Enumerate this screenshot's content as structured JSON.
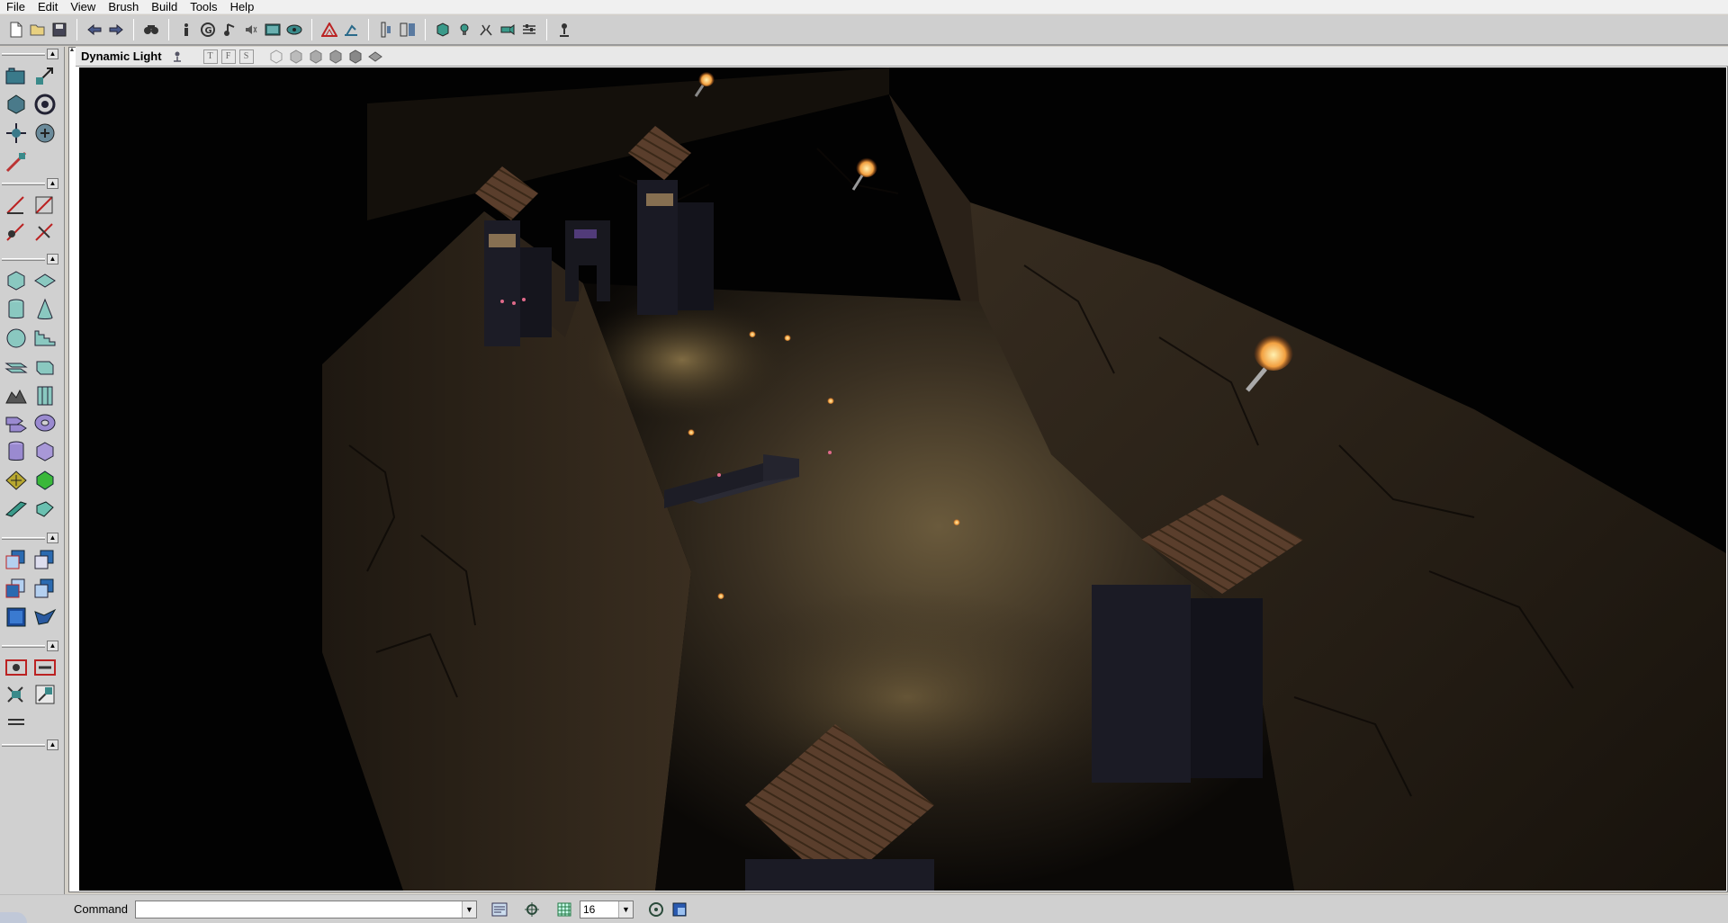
{
  "menubar": {
    "items": [
      "File",
      "Edit",
      "View",
      "Brush",
      "Build",
      "Tools",
      "Help"
    ]
  },
  "toolbar": {
    "icons": [
      "new-map-icon",
      "open-map-icon",
      "save-map-icon",
      "undo-icon",
      "redo-icon",
      "find-actors-icon",
      "actor-properties-icon",
      "group-browser-icon",
      "sound-browser-icon",
      "music-browser-icon",
      "texture-browser-icon",
      "mesh-browser-icon",
      "build-geometry-icon",
      "build-lighting-icon",
      "build-paths-icon",
      "build-all-icon",
      "play-level-icon",
      "light-icon",
      "prefab-icon",
      "static-mesh-icon",
      "settings-icon",
      "actor-icon"
    ]
  },
  "viewport": {
    "title": "Dynamic Light",
    "mode_buttons": [
      "T",
      "F",
      "S"
    ]
  },
  "status": {
    "command_label": "Command",
    "command_value": "",
    "grid_size": "16"
  },
  "colors": {
    "chrome": "#d0d0d0",
    "viewport_bg": "#000000",
    "rock": "#2a2118",
    "floor_light": "#6b5a3a",
    "torch_flame": "#f2a040"
  }
}
